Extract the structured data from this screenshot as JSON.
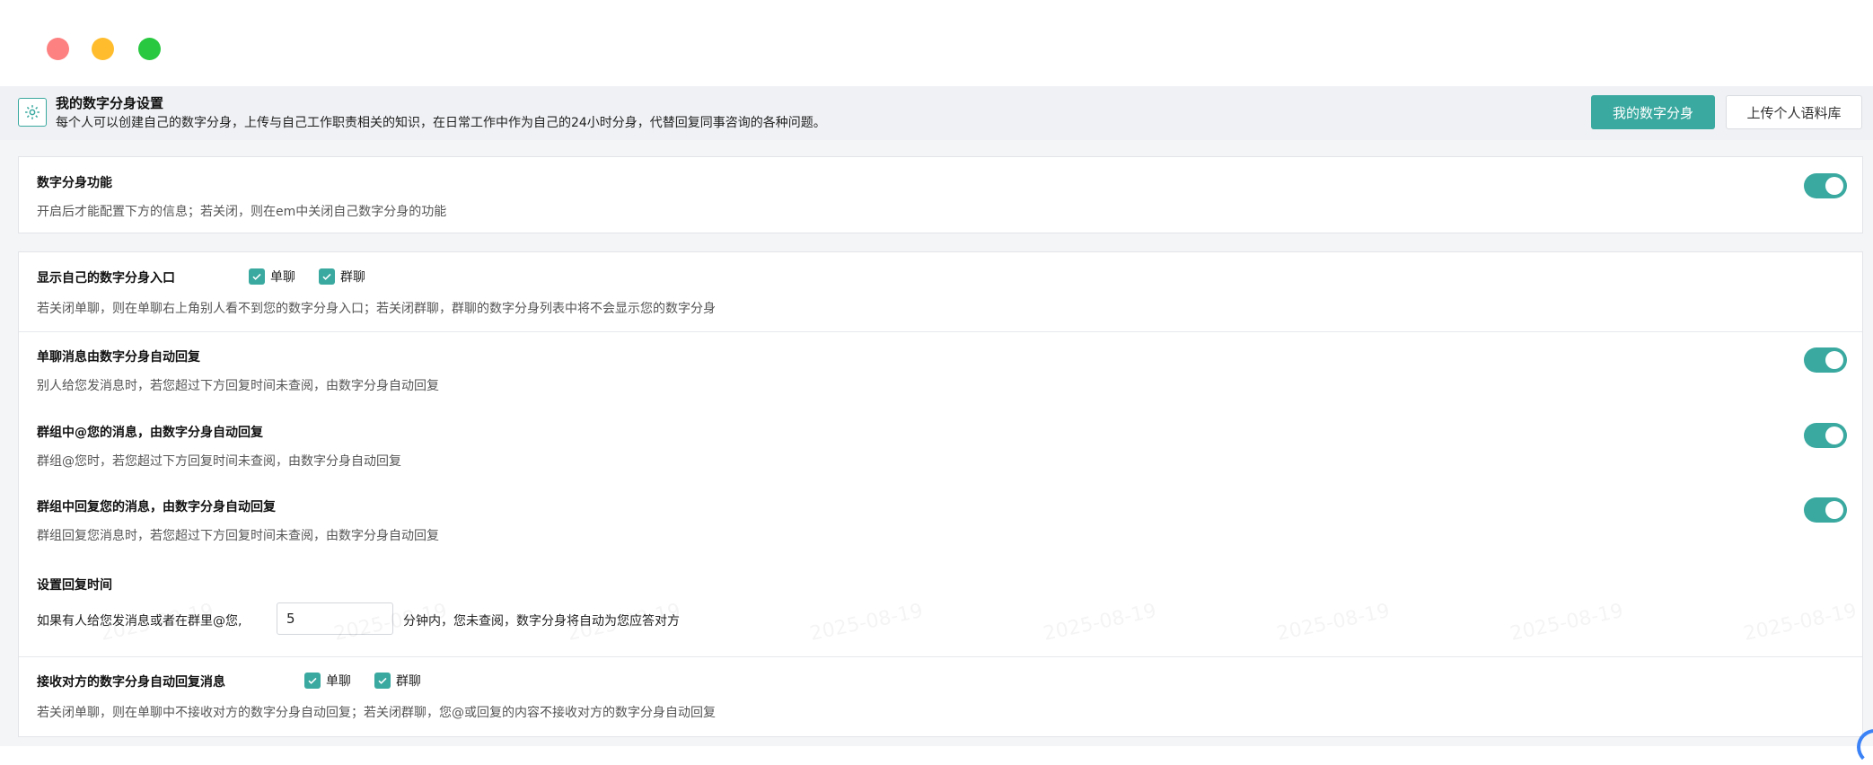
{
  "header": {
    "title": "我的数字分身设置",
    "description": "每个人可以创建自己的数字分身，上传与自己工作职责相关的知识，在日常工作中作为自己的24小时分身，代替回复同事咨询的各种问题。",
    "primary_button": "我的数字分身",
    "secondary_button": "上传个人语料库",
    "icon": "gear-icon"
  },
  "feature": {
    "title": "数字分身功能",
    "description": "开启后才能配置下方的信息；若关闭，则在em中关闭自己数字分身的功能",
    "enabled": true
  },
  "entry": {
    "title": "显示自己的数字分身入口",
    "options": [
      {
        "label": "单聊",
        "checked": true
      },
      {
        "label": "群聊",
        "checked": true
      }
    ],
    "description": "若关闭单聊，则在单聊右上角别人看不到您的数字分身入口；若关闭群聊，群聊的数字分身列表中将不会显示您的数字分身"
  },
  "auto_reply": [
    {
      "title": "单聊消息由数字分身自动回复",
      "description": "别人给您发消息时，若您超过下方回复时间未查阅，由数字分身自动回复",
      "enabled": true
    },
    {
      "title": "群组中@您的消息，由数字分身自动回复",
      "description": "群组@您时，若您超过下方回复时间未查阅，由数字分身自动回复",
      "enabled": true
    },
    {
      "title": "群组中回复您的消息，由数字分身自动回复",
      "description": "群组回复您消息时，若您超过下方回复时间未查阅，由数字分身自动回复",
      "enabled": true
    }
  ],
  "reply_time": {
    "title": "设置回复时间",
    "prefix": "如果有人给您发消息或者在群里@您,",
    "value": "5",
    "suffix": "分钟内，您未查阅，数字分身将自动为您应答对方"
  },
  "receive": {
    "title": "接收对方的数字分身自动回复消息",
    "options": [
      {
        "label": "单聊",
        "checked": true
      },
      {
        "label": "群聊",
        "checked": true
      }
    ],
    "description": "若关闭单聊，则在单聊中不接收对方的数字分身自动回复；若关闭群聊，您@或回复的内容不接收对方的数字分身自动回复"
  },
  "watermark_text": "2025-08-19",
  "colors": {
    "accent": "#3aa9a0"
  }
}
